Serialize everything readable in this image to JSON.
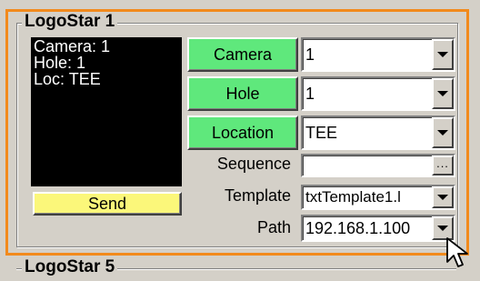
{
  "group1": {
    "title": "LogoStar 1",
    "monitor_lines": [
      "Camera: 1",
      "Hole: 1",
      "Loc: TEE"
    ],
    "send_label": "Send",
    "camera_button": "Camera",
    "camera_value": "1",
    "hole_button": "Hole",
    "hole_value": "1",
    "location_button": "Location",
    "location_value": "TEE",
    "sequence_label": "Sequence",
    "sequence_value": "",
    "browse_label": "...",
    "template_label": "Template",
    "template_value": "txtTemplate1.l",
    "path_label": "Path",
    "path_value": "192.168.1.100"
  },
  "group2": {
    "title": "LogoStar 5"
  },
  "colors": {
    "accent_border": "#f28a1c",
    "green_button": "#5fe87c",
    "yellow_button": "#fbf77a"
  }
}
